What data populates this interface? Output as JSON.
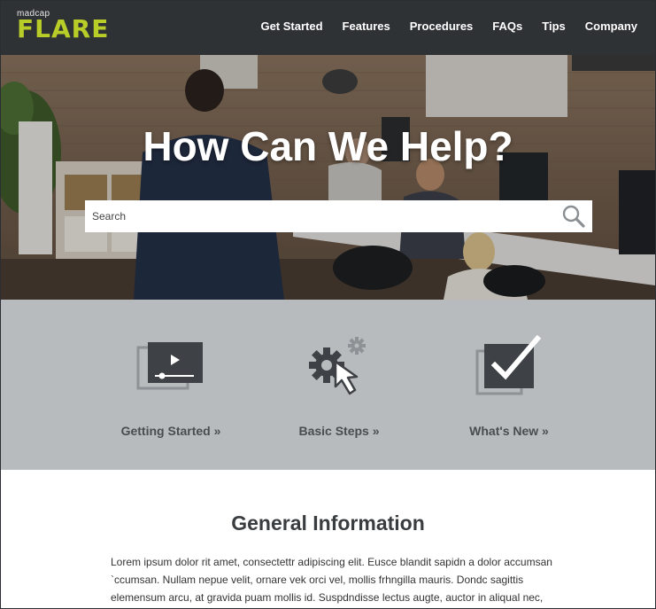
{
  "logo": {
    "small": "madcap",
    "main": "FLARE"
  },
  "nav": [
    "Get Started",
    "Features",
    "Procedures",
    "FAQs",
    "Tips",
    "Company"
  ],
  "hero": {
    "title": "How Can We Help?",
    "search_placeholder": "Search"
  },
  "tiles": [
    {
      "label": "Getting Started »",
      "icon": "video-play-icon"
    },
    {
      "label": "Basic Steps »",
      "icon": "gears-cursor-icon"
    },
    {
      "label": "What's New »",
      "icon": "checkmark-box-icon"
    }
  ],
  "content": {
    "heading": "General Information",
    "body": "Lorem ipsum dolor rit amet, consectettr adipiscing elit. Eusce blandit sapidn a dolor accumsan `ccumsan. Nullam nepue velit, ornare vek orci vel, mollis frhngilla mauris. Dondc sagittis elemensum arcu, at gravida puam mollis id. Suspdndisse lectus augte, auctor in aliqual nec,"
  },
  "colors": {
    "header_bg": "#2f3235",
    "logo": "#b8cd28",
    "tiles_bg": "#b7bbbe",
    "icon_dark": "#3e4145",
    "icon_light": "#8e9296"
  }
}
